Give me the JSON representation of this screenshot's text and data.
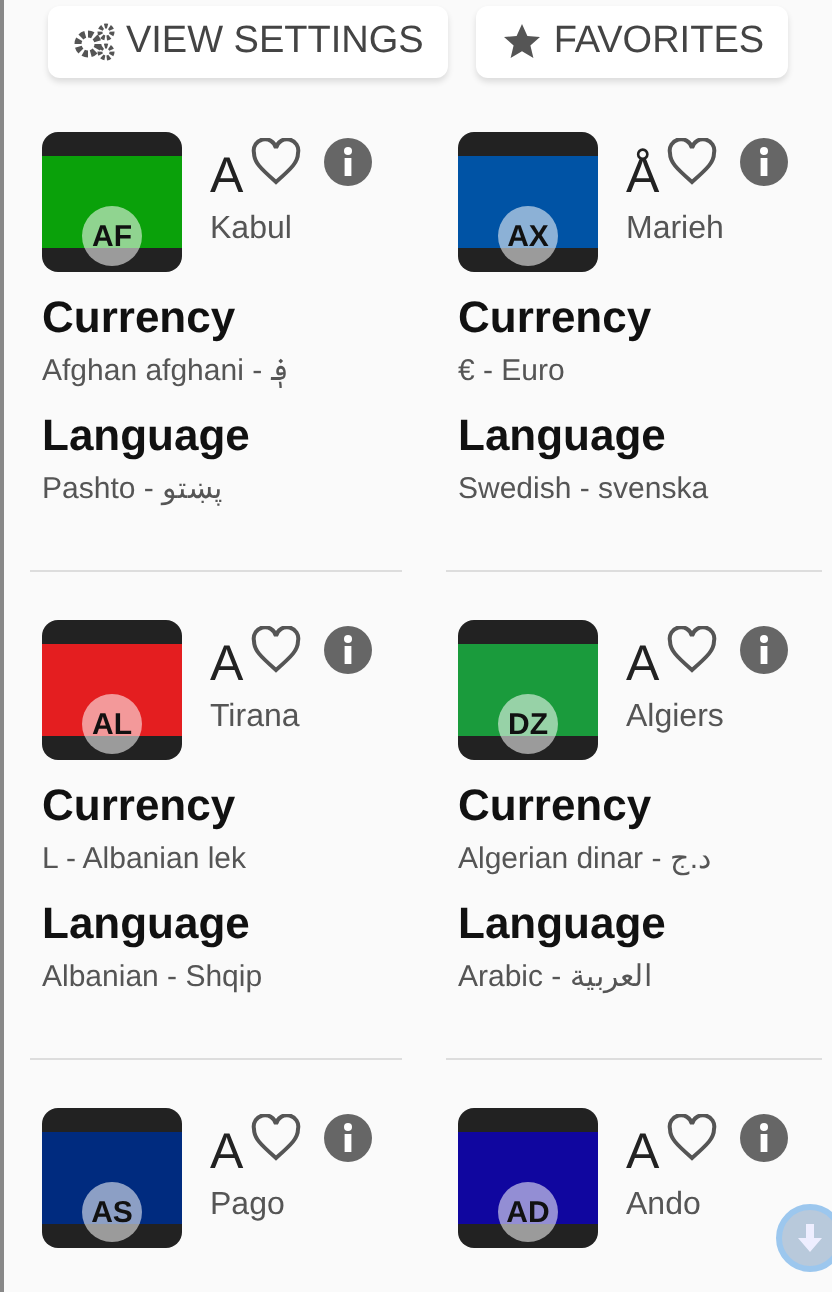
{
  "toolbar": {
    "buttons": [
      {
        "label": "VIEW SETTINGS",
        "kind": "settings"
      },
      {
        "label": "FAVORITES",
        "kind": "star"
      }
    ]
  },
  "countries": [
    {
      "code": "AF",
      "symbol": "A",
      "capital": "Kabul",
      "favorite": false,
      "color": "#0aa10a",
      "currency_heading": "Currency",
      "currency": "Afghan afghani - ؋",
      "language_heading": "Language",
      "language": "Pashto - پښتو"
    },
    {
      "code": "AX",
      "symbol": "Å",
      "capital": "Marieh",
      "favorite": false,
      "color": "#0053a5",
      "currency_heading": "Currency",
      "currency": "€ - Euro",
      "language_heading": "Language",
      "language": "Swedish - svenska"
    },
    {
      "code": "AL",
      "symbol": "A",
      "capital": "Tirana",
      "favorite": false,
      "color": "#e41e20",
      "currency_heading": "Currency",
      "currency": "L - Albanian lek",
      "language_heading": "Language",
      "language": "Albanian - Shqip"
    },
    {
      "code": "DZ",
      "symbol": "A",
      "capital": "Algiers",
      "favorite": false,
      "color": "#1a9b3c",
      "currency_heading": "Currency",
      "currency": "Algerian dinar - د.ج",
      "language_heading": "Language",
      "language": "Arabic - العربية"
    },
    {
      "code": "AS",
      "symbol": "A",
      "capital": "Pago",
      "favorite": false,
      "color": "#002b7f"
    },
    {
      "code": "AD",
      "symbol": "A",
      "capital": "Ando",
      "favorite": false,
      "color": "#10069f"
    }
  ]
}
